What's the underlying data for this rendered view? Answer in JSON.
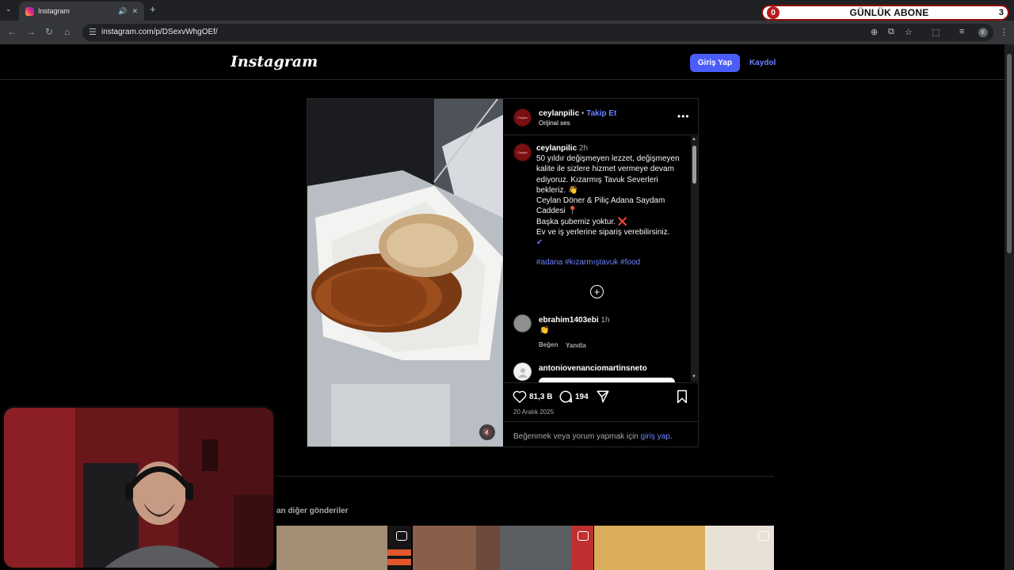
{
  "browser": {
    "tab_title": "Instagram",
    "url": "instagram.com/p/DSexvWhgOEf/",
    "profile_initial": "E"
  },
  "overlay": {
    "label": "GÜNLÜK ABONE",
    "left_count": "0",
    "right_count": "3"
  },
  "instagram": {
    "logo": "Instagram",
    "login_button": "Giriş Yap",
    "signup_link": "Kaydol"
  },
  "post": {
    "author": "ceylanpilic",
    "separator": "•",
    "follow": "Takip Et",
    "audio": "Orijinal ses",
    "avatar_text": "Ceylan",
    "caption": {
      "author": "ceylanpilic",
      "time": "2h",
      "lines": [
        "50 yıldır değişmeyen lezzet, değişmeyen",
        "kalite ile sizlere hizmet vermeye devam",
        "ediyoruz. Kızarmış Tavuk Severleri",
        "bekleriz. 👋",
        "Ceylan Döner & Piliç Adana Saydam",
        "Caddesi 📍",
        "Başka şubemiz yoktur. ❌",
        "Ev ve iş yerlerine sipariş verebilirsiniz.",
        "✔"
      ],
      "hashtags": "#adana #kızarmıştavuk #food"
    },
    "comments": [
      {
        "user": "ebrahim1403ebi",
        "time": "1h",
        "text": "👏",
        "like": "Beğen",
        "reply": "Yanıtla"
      },
      {
        "user": "antoniovenanciomartinsneto"
      }
    ],
    "likes": "81,3 B",
    "comments_count": "194",
    "date": "20 Aralık 2025",
    "login_prompt_prefix": "Beğenmek veya yorum yapmak için",
    "login_prompt_link": "giriş yap",
    "login_prompt_suffix": "."
  },
  "more_posts": {
    "label": "an diğer gönderiler"
  },
  "colors": {
    "accent_blue": "#4a5df9",
    "link_blue": "#6c83ff",
    "background": "#000000"
  }
}
